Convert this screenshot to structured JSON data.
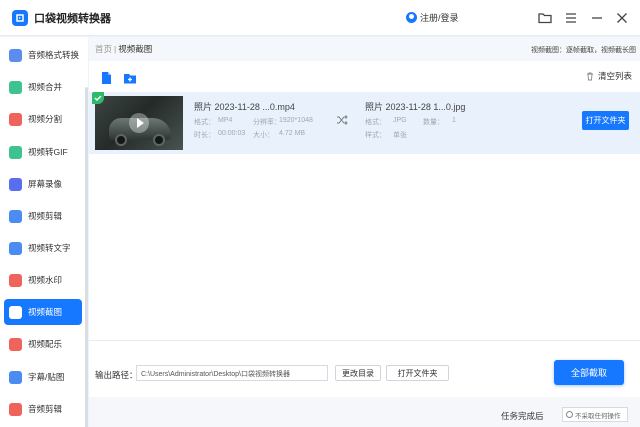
{
  "app": {
    "title": "口袋视频转换器",
    "login": "注册/登录",
    "brand_color": "#1677ff"
  },
  "window_controls": [
    "folder-icon",
    "menu-icon",
    "minimize-icon",
    "close-icon"
  ],
  "sidebar": {
    "items": [
      {
        "label": "音频格式转换",
        "icon": "audio-format-icon",
        "color": "#5b8def",
        "active": false
      },
      {
        "label": "视频合并",
        "icon": "video-merge-icon",
        "color": "#3ec28f",
        "active": false
      },
      {
        "label": "视频分割",
        "icon": "video-split-icon",
        "color": "#f0635b",
        "active": false
      },
      {
        "label": "视频转GIF",
        "icon": "video-gif-icon",
        "color": "#3ec28f",
        "active": false
      },
      {
        "label": "屏幕录像",
        "icon": "screen-record-icon",
        "color": "#5b6def",
        "active": false
      },
      {
        "label": "视频剪辑",
        "icon": "video-edit-icon",
        "color": "#4a8cf0",
        "active": false
      },
      {
        "label": "视频转文字",
        "icon": "video-text-icon",
        "color": "#4a8cf0",
        "active": false
      },
      {
        "label": "视频水印",
        "icon": "video-watermark-icon",
        "color": "#f0635b",
        "active": false
      },
      {
        "label": "视频截图",
        "icon": "video-screenshot-icon",
        "color": "#7b5bef",
        "active": true
      },
      {
        "label": "视频配乐",
        "icon": "video-music-icon",
        "color": "#f0635b",
        "active": false
      },
      {
        "label": "字幕/贴图",
        "icon": "subtitle-sticker-icon",
        "color": "#4a8cf0",
        "active": false
      },
      {
        "label": "音频剪辑",
        "icon": "audio-edit-icon",
        "color": "#f0635b",
        "active": false
      }
    ]
  },
  "breadcrumb": {
    "home": "首页",
    "separator": "|",
    "current": "视频截图"
  },
  "tips": "视频截图：逐帧截取，视频截长图",
  "toolbar": {
    "add_file_icon": "add-file-icon",
    "add_folder_icon": "add-folder-icon",
    "clear_label": "清空列表"
  },
  "file": {
    "src_name": "照片 2023-11-28 ...0.mp4",
    "format_label": "格式：",
    "format_value": "MP4",
    "resolution_label": "分辨率：",
    "resolution_value": "1920*1048",
    "duration_label": "时长：",
    "duration_value": "00:00:03",
    "size_label": "大小：",
    "size_value": "4.72 MB",
    "dst_name": "照片 2023-11-28 1...0.jpg",
    "dst_format_label": "格式：",
    "dst_format_value": "JPG",
    "count_label": "数量：",
    "count_value": "1",
    "style_label": "样式：",
    "style_value": "单张",
    "open_folder": "打开文件夹"
  },
  "bottom": {
    "output_label": "输出路径：",
    "output_path": "C:\\Users\\Administrator\\Desktop\\口袋视频转换器",
    "change_dir": "更改目录",
    "open_folder": "打开文件夹",
    "convert_all": "全部截取",
    "after_label": "任务完成后",
    "after_value": "不采取任何操作"
  }
}
